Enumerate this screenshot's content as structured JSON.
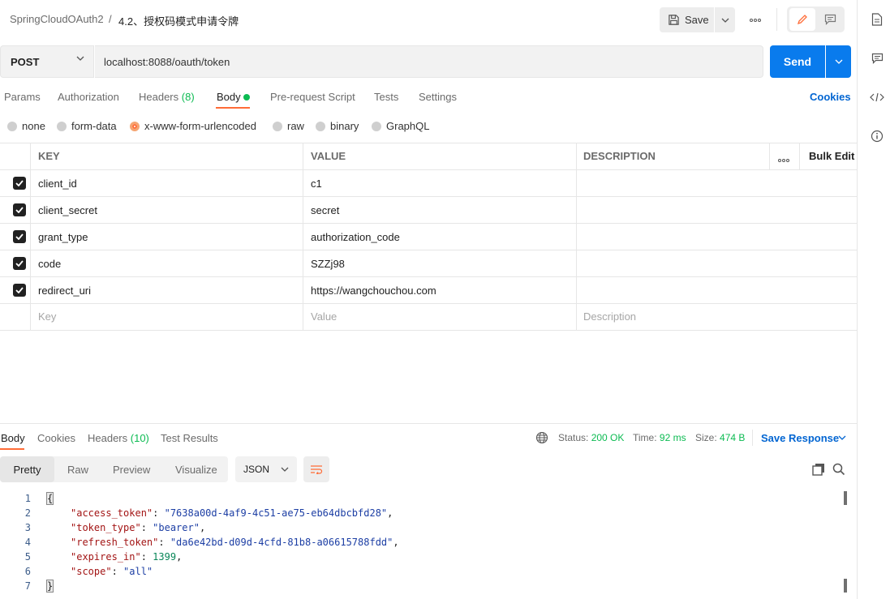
{
  "header": {
    "collection": "SpringCloudOAuth2",
    "separator": "/",
    "request_name": "4.2、授权码模式申请令牌",
    "save_label": "Save",
    "more_label": "ooo"
  },
  "request": {
    "method": "POST",
    "url": "localhost:8088/oauth/token",
    "send_label": "Send"
  },
  "request_tabs": [
    {
      "label": "Params"
    },
    {
      "label": "Authorization"
    },
    {
      "label": "Headers",
      "count": "(8)"
    },
    {
      "label": "Body"
    },
    {
      "label": "Pre-request Script"
    },
    {
      "label": "Tests"
    },
    {
      "label": "Settings"
    }
  ],
  "cookies_label": "Cookies",
  "body_modes": [
    "none",
    "form-data",
    "x-www-form-urlencoded",
    "raw",
    "binary",
    "GraphQL"
  ],
  "selected_body_mode": "x-www-form-urlencoded",
  "table": {
    "headers": {
      "key": "KEY",
      "value": "VALUE",
      "description": "DESCRIPTION",
      "more": "ooo",
      "bulk_edit": "Bulk Edit"
    },
    "rows": [
      {
        "key": "client_id",
        "value": "c1",
        "description": "",
        "checked": true
      },
      {
        "key": "client_secret",
        "value": "secret",
        "description": "",
        "checked": true
      },
      {
        "key": "grant_type",
        "value": "authorization_code",
        "description": "",
        "checked": true
      },
      {
        "key": "code",
        "value": "SZZj98",
        "description": "",
        "checked": true
      },
      {
        "key": "redirect_uri",
        "value": "https://wangchouchou.com",
        "description": "",
        "checked": true
      }
    ],
    "placeholders": {
      "key": "Key",
      "value": "Value",
      "description": "Description"
    }
  },
  "response": {
    "tabs": [
      {
        "label": "Body"
      },
      {
        "label": "Cookies"
      },
      {
        "label": "Headers",
        "count": "(10)"
      },
      {
        "label": "Test Results"
      }
    ],
    "status_label": "Status:",
    "status_value": "200 OK",
    "time_label": "Time:",
    "time_value": "92 ms",
    "size_label": "Size:",
    "size_value": "474 B",
    "save_response_label": "Save Response",
    "views": [
      "Pretty",
      "Raw",
      "Preview",
      "Visualize"
    ],
    "format": "JSON",
    "code_lines": [
      {
        "n": "1",
        "key": "",
        "value": "",
        "text": "{"
      },
      {
        "n": "2",
        "key": "\"access_token\"",
        "value": "\"7638a00d-4af9-4c51-ae75-eb64dbcbfd28\"",
        "type": "s"
      },
      {
        "n": "3",
        "key": "\"token_type\"",
        "value": "\"bearer\"",
        "type": "s"
      },
      {
        "n": "4",
        "key": "\"refresh_token\"",
        "value": "\"da6e42bd-d09d-4cfd-81b8-a06615788fdd\"",
        "type": "s"
      },
      {
        "n": "5",
        "key": "\"expires_in\"",
        "value": "1399",
        "type": "n"
      },
      {
        "n": "6",
        "key": "\"scope\"",
        "value": "\"all\"",
        "type": "s",
        "last": true
      },
      {
        "n": "7",
        "key": "",
        "value": "",
        "text": "}"
      }
    ]
  },
  "colors": {
    "accent": "#ff6c37",
    "primary": "#097bed",
    "success": "#0cbb52"
  }
}
